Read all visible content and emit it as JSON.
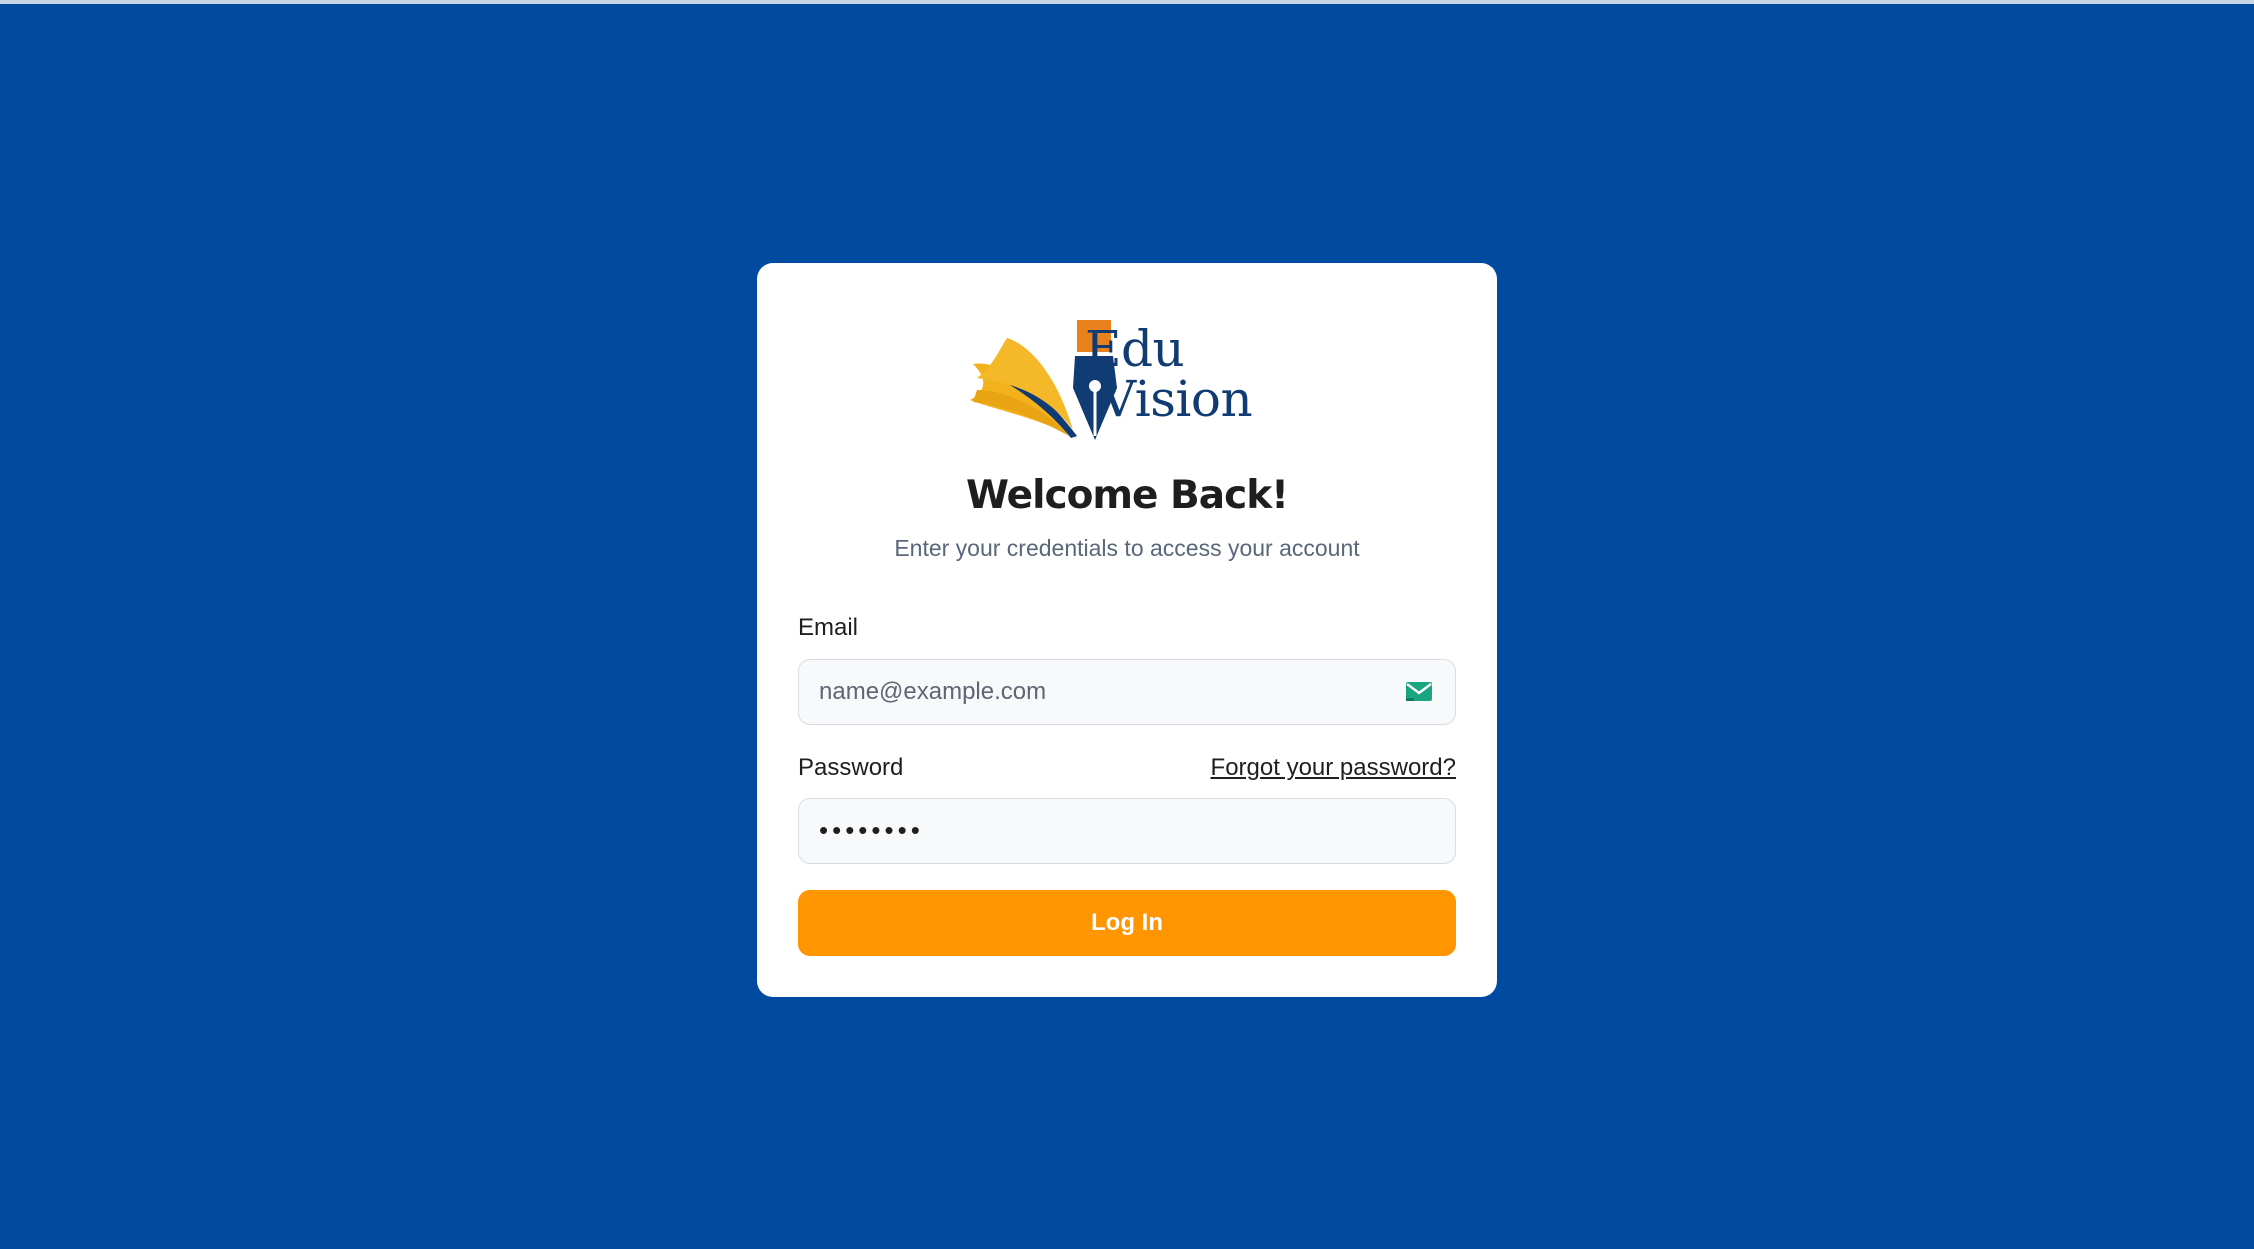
{
  "colors": {
    "background": "#004aa0",
    "card": "#ffffff",
    "accent": "#ff9500",
    "logo_navy": "#103b73",
    "logo_orange": "#e9821c",
    "logo_yellow": "#f3b21b",
    "mail_icon": "#1aa581"
  },
  "logo": {
    "line1": "Edu",
    "line2": "Vision",
    "icon": "book-pen-logo-icon"
  },
  "header": {
    "title": "Welcome Back!",
    "subtitle": "Enter your credentials to access your account"
  },
  "form": {
    "email_label": "Email",
    "email_placeholder": "name@example.com",
    "email_value": "",
    "email_icon": "mail-icon",
    "password_label": "Password",
    "forgot_link": "Forgot your password?",
    "password_value": "password",
    "submit_label": "Log In"
  }
}
